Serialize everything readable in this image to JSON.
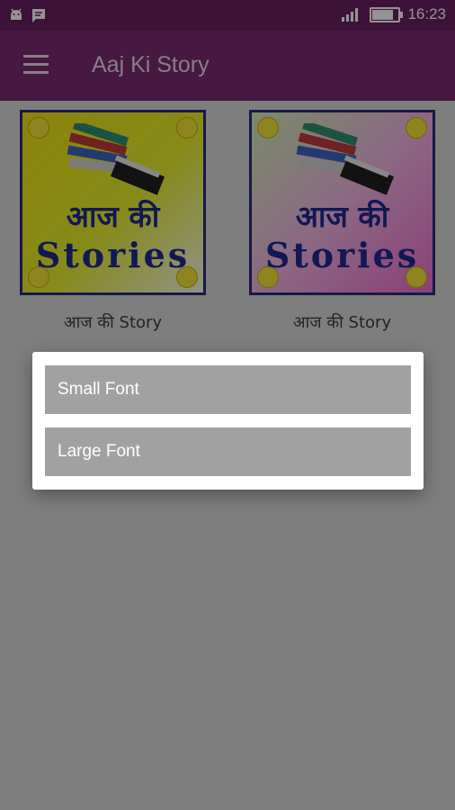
{
  "status_bar": {
    "time": "16:23",
    "icons": [
      "android-icon",
      "message-icon",
      "signal-icon",
      "battery-icon"
    ],
    "battery_level": 0.9
  },
  "app_bar": {
    "title": "Aaj Ki Story",
    "menu_icon": "hamburger-icon"
  },
  "stories": [
    {
      "hindi": "आज की",
      "latin": "Stories",
      "caption": "आज की Story"
    },
    {
      "hindi": "आज की",
      "latin": "Stories",
      "caption": "आज की Story"
    }
  ],
  "dialog": {
    "options": [
      "Small Font",
      "Large Font"
    ]
  },
  "colors": {
    "status_bar": "#6a1f62",
    "app_bar": "#7b2a72",
    "dialog_button": "#a1a1a1"
  }
}
